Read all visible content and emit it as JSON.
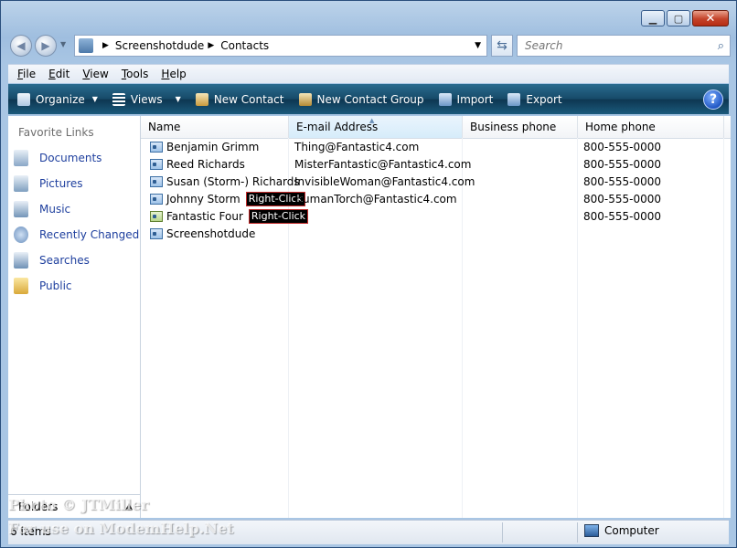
{
  "address": {
    "crumbs": [
      "Screenshotdude",
      "Contacts"
    ]
  },
  "search": {
    "placeholder": "Search"
  },
  "menu": [
    "File",
    "Edit",
    "View",
    "Tools",
    "Help"
  ],
  "toolbar": {
    "organize": "Organize",
    "views": "Views",
    "new_contact": "New Contact",
    "new_group": "New Contact Group",
    "import": "Import",
    "export": "Export"
  },
  "sidebar": {
    "title": "Favorite Links",
    "items": [
      {
        "label": "Documents",
        "icon": "documents-icon"
      },
      {
        "label": "Pictures",
        "icon": "pictures-icon"
      },
      {
        "label": "Music",
        "icon": "music-icon"
      },
      {
        "label": "Recently Changed",
        "icon": "recently-changed-icon"
      },
      {
        "label": "Searches",
        "icon": "searches-icon"
      },
      {
        "label": "Public",
        "icon": "public-folder-icon"
      }
    ],
    "folders_label": "Folders"
  },
  "columns": [
    "Name",
    "E-mail Address",
    "Business phone",
    "Home phone"
  ],
  "rows": [
    {
      "name": "Benjamin Grimm",
      "email": "Thing@Fantastic4.com",
      "business": "",
      "home": "800-555-0000",
      "tag": ""
    },
    {
      "name": "Reed Richards",
      "email": "MisterFantastic@Fantastic4.com",
      "business": "",
      "home": "800-555-0000",
      "tag": ""
    },
    {
      "name": "Susan (Storm-) Richards",
      "email": "InvisibleWoman@Fantastic4.com",
      "business": "",
      "home": "800-555-0000",
      "tag": ""
    },
    {
      "name": "Johnny Storm",
      "email": "HumanTorch@Fantastic4.com",
      "business": "",
      "home": "800-555-0000",
      "tag": "Right-Click"
    },
    {
      "name": "Fantastic Four",
      "email": "",
      "business": "",
      "home": "800-555-0000",
      "tag": "Right-Click"
    },
    {
      "name": "Screenshotdude",
      "email": "",
      "business": "",
      "home": "",
      "tag": ""
    }
  ],
  "status": {
    "count": "6 items",
    "computer": "Computer"
  },
  "watermark": {
    "line1": "Photo © JTMiller",
    "line2": "For use on ModemHelp.Net"
  }
}
